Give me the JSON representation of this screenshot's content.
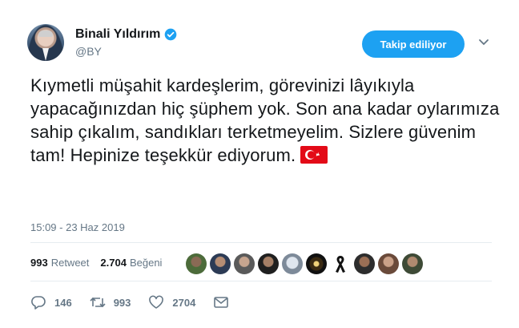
{
  "author": {
    "display_name": "Binali Yıldırım",
    "handle": "@BY"
  },
  "follow_button": "Takip ediliyor",
  "tweet": {
    "text": "Kıymetli müşahit kardeşlerim, görevinizi lâyıkıyla yapacağınızdan hiç şüphem yok. Son ana kadar oylarımıza sahip çıkalım, sandıkları terketmeyelim. Sizlere güvenim tam! Hepinize teşekkür ediyorum.",
    "timestamp": "15:09 - 23 Haz 2019"
  },
  "stats": {
    "retweets": "993",
    "retweets_label": "Retweet",
    "likes": "2.704",
    "likes_label": "Beğeni"
  },
  "actions": {
    "reply_count": "146",
    "retweet_count": "993",
    "like_count": "2704"
  },
  "colors": {
    "accent": "#1da1f2",
    "secondary_text": "#657786",
    "flag_red": "#e30a17"
  },
  "icons": [
    "verified-icon",
    "caret-down-icon",
    "turkish-flag-icon",
    "black-ribbon-icon",
    "reply-icon",
    "retweet-icon",
    "heart-icon",
    "mail-icon"
  ]
}
